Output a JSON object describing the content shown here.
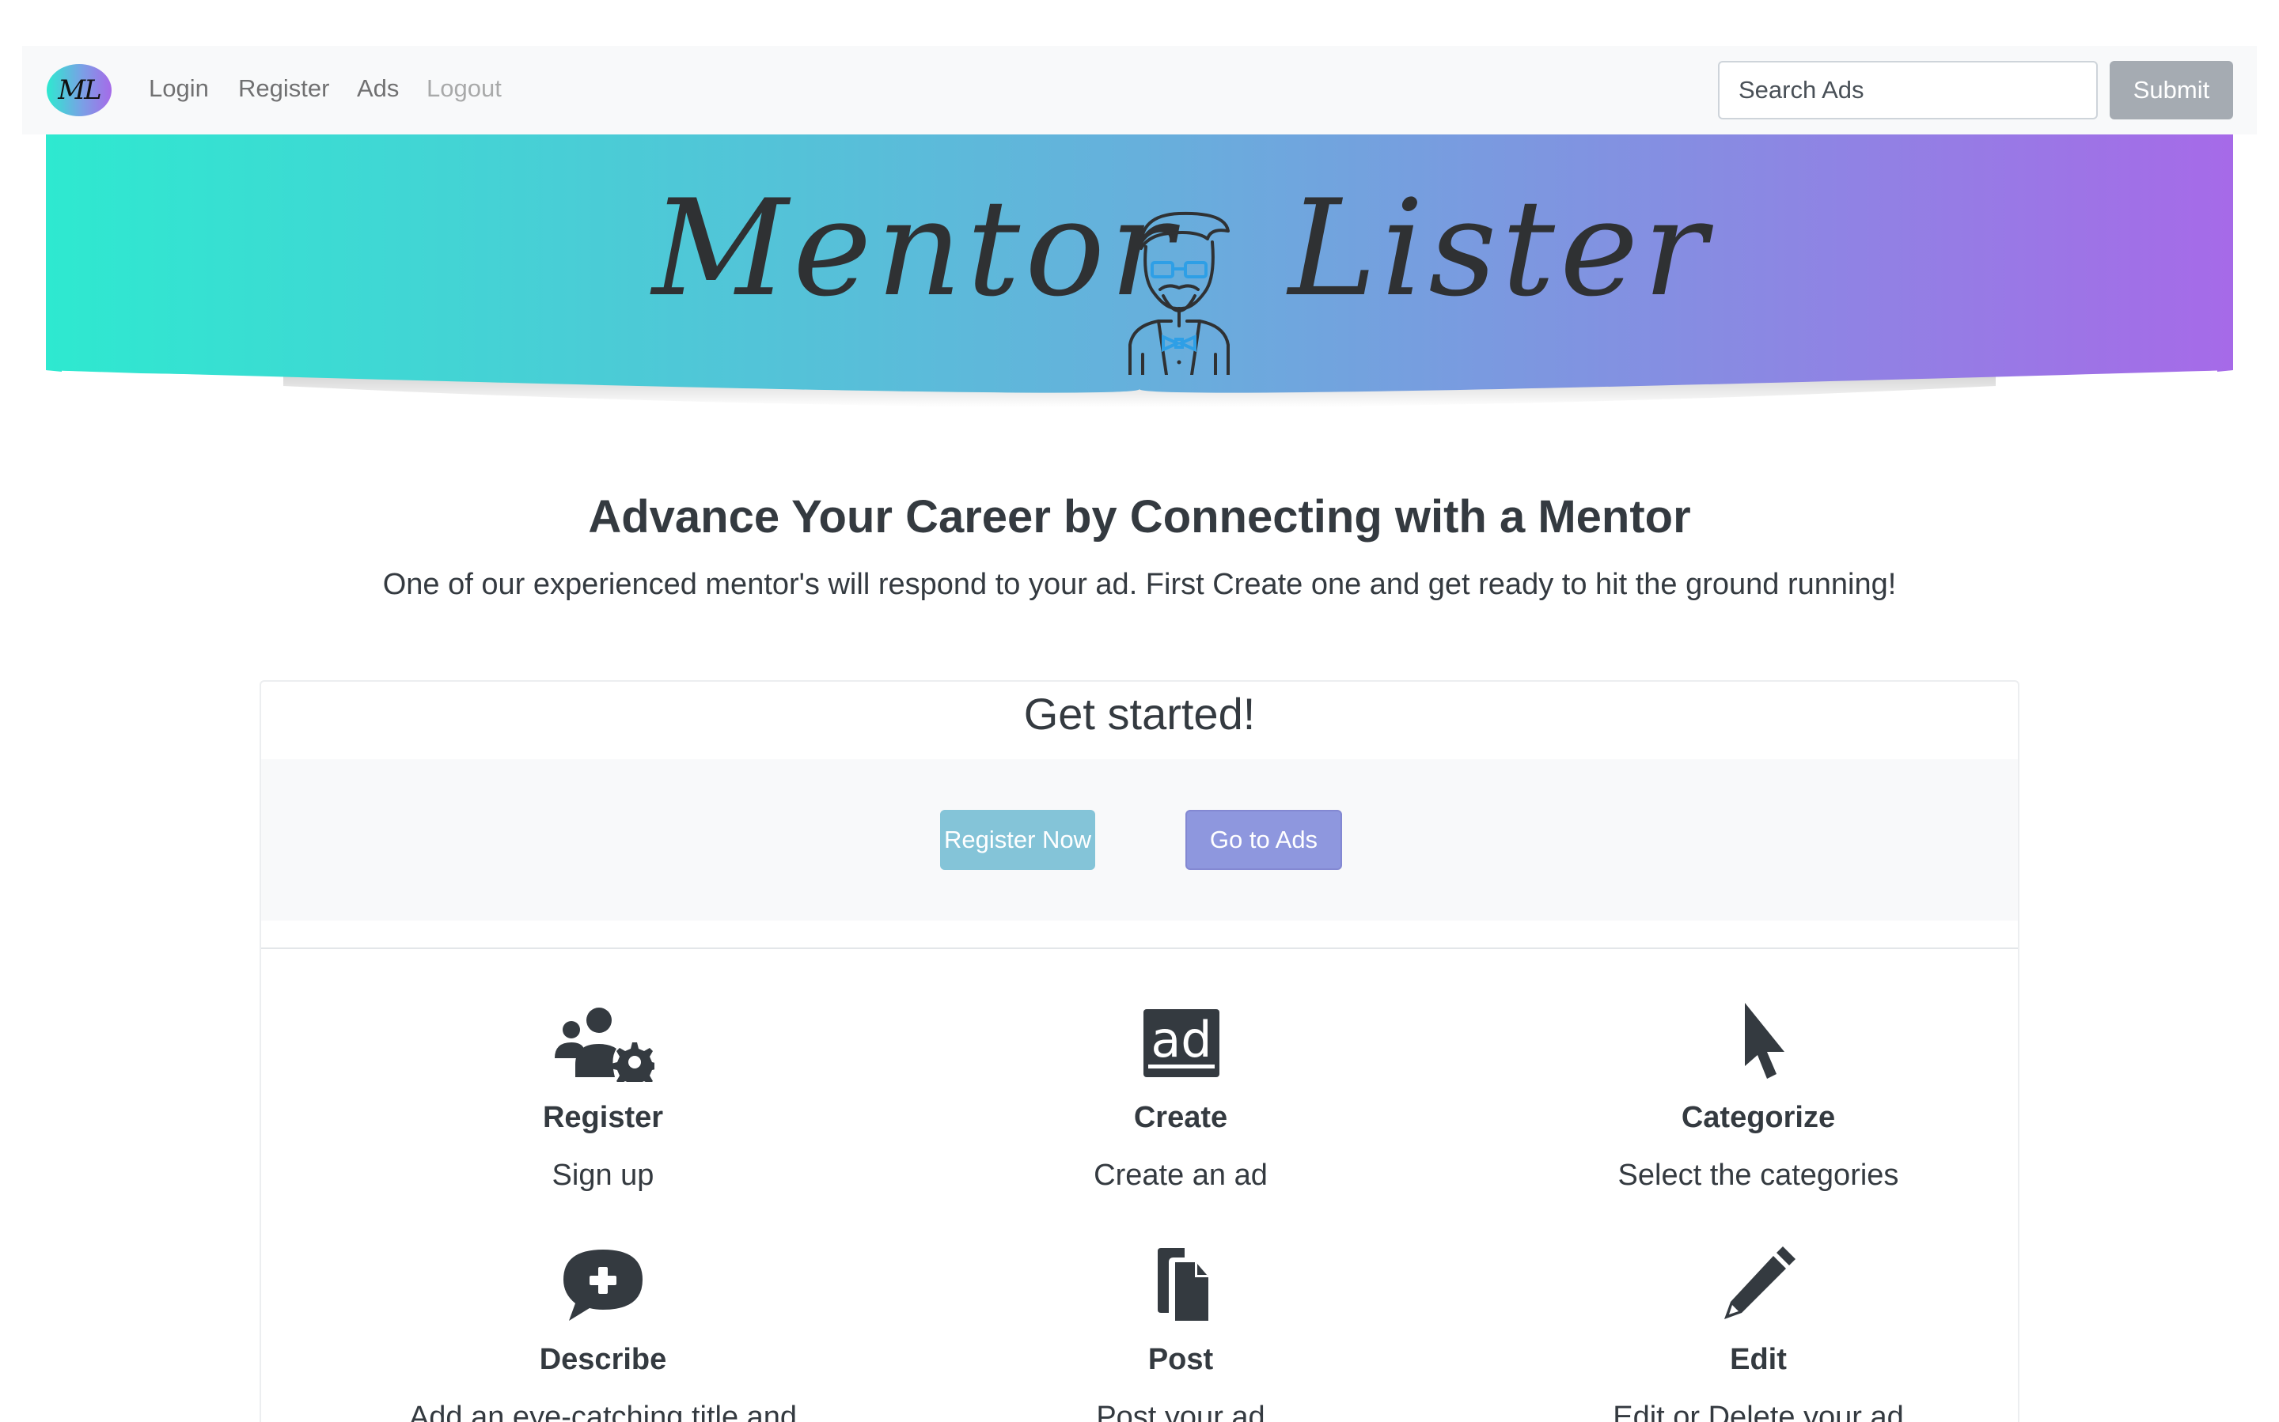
{
  "navbar": {
    "brand": "ML",
    "links": [
      "Login",
      "Register",
      "Ads",
      "Logout"
    ],
    "search_placeholder": "Search Ads",
    "submit_label": "Submit"
  },
  "hero": {
    "word_left": "Mentor",
    "word_right": "Lister",
    "gradient": [
      "#2ee9d0",
      "#5fb4dc",
      "#a66ae8"
    ],
    "mascot_icon": "hipster-mentor-icon"
  },
  "intro": {
    "headline": "Advance Your Career by Connecting with a Mentor",
    "lead": "One of our experienced mentor's will respond to your ad. First Create one and get ready to hit the ground running!"
  },
  "get_started": {
    "title": "Get started!",
    "register_label": "Register Now",
    "ads_label": "Go to Ads"
  },
  "features": [
    {
      "icon": "users-cog-icon",
      "title": "Register",
      "desc": "Sign up"
    },
    {
      "icon": "ad-icon",
      "title": "Create",
      "desc": "Create an ad"
    },
    {
      "icon": "mouse-pointer-icon",
      "title": "Categorize",
      "desc": "Select the categories"
    },
    {
      "icon": "comment-plus-icon",
      "title": "Describe",
      "desc": "Add an eye-catching title and"
    },
    {
      "icon": "copy-file-icon",
      "title": "Post",
      "desc": "Post your ad"
    },
    {
      "icon": "pencil-icon",
      "title": "Edit",
      "desc": "Edit or Delete your ad"
    }
  ],
  "colors": {
    "dark": "#343a40",
    "register_btn": "#84c4d8",
    "ads_btn": "#8e97de",
    "submit_btn": "#a5abb2"
  }
}
